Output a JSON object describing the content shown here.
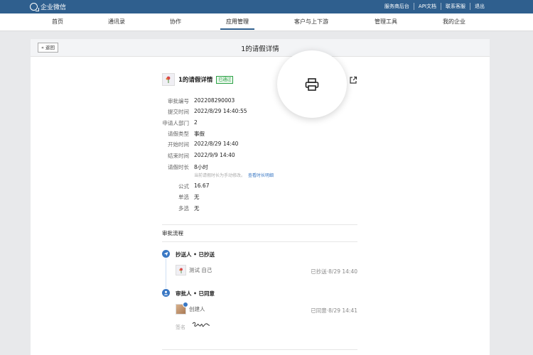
{
  "topbar": {
    "brand": "企业微信",
    "links": [
      "服务商后台",
      "API文档",
      "联系客服",
      "退出"
    ]
  },
  "nav": {
    "items": [
      "首页",
      "通讯录",
      "协作",
      "应用管理",
      "客户与上下游",
      "管理工具",
      "我的企业"
    ],
    "active": "应用管理"
  },
  "page": {
    "back_label": "« 返回",
    "title": "1的请假详情"
  },
  "detail": {
    "title": "1的请假详情",
    "status_badge": "已通过",
    "fields": [
      {
        "label": "审批编号",
        "value": "202208290003"
      },
      {
        "label": "提交时间",
        "value": "2022/8/29 14:40:55"
      },
      {
        "label": "申请人部门",
        "value": "2"
      },
      {
        "label": "请假类型",
        "value": "事假"
      },
      {
        "label": "开始时间",
        "value": "2022/8/29 14:40"
      },
      {
        "label": "结束时间",
        "value": "2022/9/9 14:40"
      },
      {
        "label": "请假时长",
        "value": "8小时"
      }
    ],
    "hint_text": "当前请假时长为手动修改。",
    "hint_link": "查看时长明细",
    "extra_fields": [
      {
        "label": "公式",
        "value": "16.67"
      },
      {
        "label": "单选",
        "value": "无"
      },
      {
        "label": "多选",
        "value": "无"
      }
    ]
  },
  "flow": {
    "section_title": "审批流程",
    "steps": [
      {
        "label": "抄送人 • 已抄送",
        "person": "测试 自己",
        "status": "已抄送·8/29 14:40"
      },
      {
        "label": "审批人 • 已同意",
        "person": "创建人",
        "status": "已同意·8/29 14:41"
      }
    ],
    "sign_label": "签名"
  },
  "colors": {
    "topbar": "#2f5f8e",
    "accent": "#3a78c4",
    "approved": "#2ba245"
  }
}
